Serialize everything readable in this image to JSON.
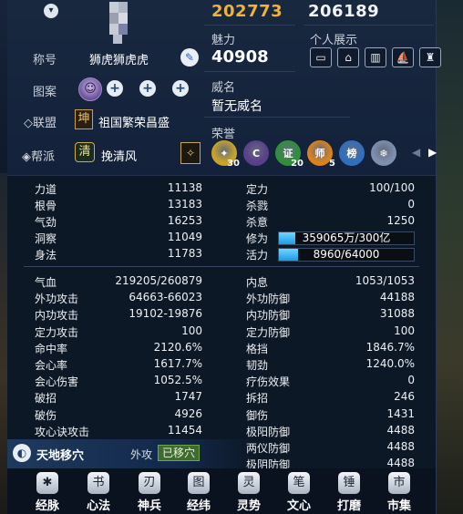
{
  "header": {
    "combat_power": "202773",
    "combat_power_2": "206189",
    "charm_label": "魅力",
    "charm_value": "40908",
    "showcase_label": "个人展示",
    "title_label": "称号",
    "title_value": "狮虎狮虎虎",
    "pattern_label": "图案",
    "fame_label": "威名",
    "fame_value": "暂无威名",
    "alliance_label": "◇联盟",
    "alliance_badge": "坤",
    "alliance_name": "祖国繁荣昌盛",
    "guild_label": "帮派",
    "guild_badge": "清",
    "guild_name": "挽清风",
    "honor_label": "荣誉",
    "honors": [
      {
        "glyph": "✦",
        "num": "30",
        "color": "#c9a22a"
      },
      {
        "glyph": "C",
        "num": "",
        "color": "#5a3f8a"
      },
      {
        "glyph": "证",
        "num": "20",
        "color": "#2f8f3a"
      },
      {
        "glyph": "师",
        "num": "5",
        "color": "#d9821e"
      },
      {
        "glyph": "榜",
        "num": "",
        "color": "#2f6fbf"
      },
      {
        "glyph": "❄",
        "num": "",
        "color": "#7d8fae"
      }
    ]
  },
  "stats_basic_left": [
    {
      "label": "力道",
      "value": "11138"
    },
    {
      "label": "根骨",
      "value": "13183"
    },
    {
      "label": "气劲",
      "value": "16253"
    },
    {
      "label": "洞察",
      "value": "11049"
    },
    {
      "label": "身法",
      "value": "11783"
    }
  ],
  "stats_basic_right": [
    {
      "label": "定力",
      "value": "100/100"
    },
    {
      "label": "杀戮",
      "value": "0"
    },
    {
      "label": "杀意",
      "value": "1250"
    }
  ],
  "cultivation": {
    "label": "修为",
    "text": "359065万/300亿",
    "fraction": 0.12
  },
  "vitality": {
    "label": "活力",
    "text": "8960/64000",
    "fraction": 0.14
  },
  "stats_combat_left": [
    {
      "label": "气血",
      "value": "219205/260879"
    },
    {
      "label": "外功攻击",
      "value": "64663-66023"
    },
    {
      "label": "内功攻击",
      "value": "19102-19876"
    },
    {
      "label": "定力攻击",
      "value": "100"
    },
    {
      "label": "命中率",
      "value": "2120.6%"
    },
    {
      "label": "会心率",
      "value": "1617.7%"
    },
    {
      "label": "会心伤害",
      "value": "1052.5%"
    },
    {
      "label": "破招",
      "value": "1747"
    },
    {
      "label": "破伤",
      "value": "4926"
    },
    {
      "label": "攻心诀攻击",
      "value": "11454"
    }
  ],
  "stats_combat_right": [
    {
      "label": "内息",
      "value": "1053/1053"
    },
    {
      "label": "外功防御",
      "value": "44188"
    },
    {
      "label": "内功防御",
      "value": "31088"
    },
    {
      "label": "定力防御",
      "value": "100"
    },
    {
      "label": "格挡",
      "value": "1846.7%"
    },
    {
      "label": "韧劲",
      "value": "1240.0%"
    },
    {
      "label": "疗伤效果",
      "value": "0"
    },
    {
      "label": "拆招",
      "value": "246"
    },
    {
      "label": "御伤",
      "value": "1431"
    },
    {
      "label": "极阳防御",
      "value": "4488"
    },
    {
      "label": "两仪防御",
      "value": "4488"
    },
    {
      "label": "极阴防御",
      "value": "4488"
    }
  ],
  "skill": {
    "name": "天地移穴",
    "type": "外攻",
    "state": "已移穴"
  },
  "nav": [
    {
      "label": "经脉",
      "glyph": "✱"
    },
    {
      "label": "心法",
      "glyph": "书"
    },
    {
      "label": "神兵",
      "glyph": "刃"
    },
    {
      "label": "经纬",
      "glyph": "图"
    },
    {
      "label": "灵势",
      "glyph": "灵"
    },
    {
      "label": "文心",
      "glyph": "笔"
    },
    {
      "label": "打磨",
      "glyph": "锤"
    },
    {
      "label": "市集",
      "glyph": "市"
    }
  ],
  "colors": {
    "combat": "#f2b13a",
    "bar_fill": "#1f9ae3",
    "skill_state": "#3f6b2f"
  }
}
